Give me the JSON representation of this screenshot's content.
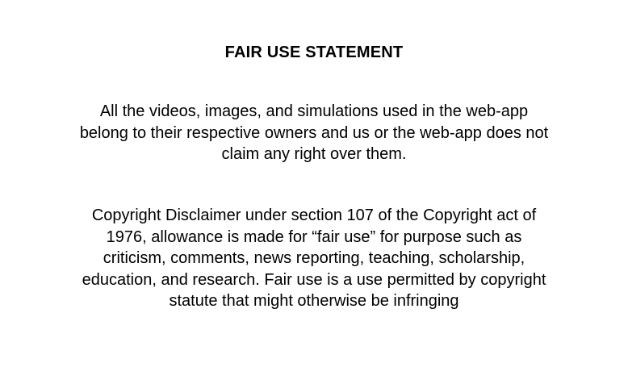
{
  "document": {
    "title": "FAIR USE STATEMENT",
    "paragraphs": [
      {
        "lines": [
          "All the videos, images, and simulations used in the web-app",
          "belong to their respective owners and us or the web-app does not",
          "claim any right over them."
        ]
      },
      {
        "lines": [
          "Copyright Disclaimer under section 107 of the Copyright act of",
          "1976, allowance is made for “fair use” for purpose such as",
          "criticism, comments, news reporting, teaching, scholarship,",
          "education, and research. Fair use is a use permitted by copyright",
          "statute that might otherwise be infringing"
        ]
      }
    ]
  }
}
